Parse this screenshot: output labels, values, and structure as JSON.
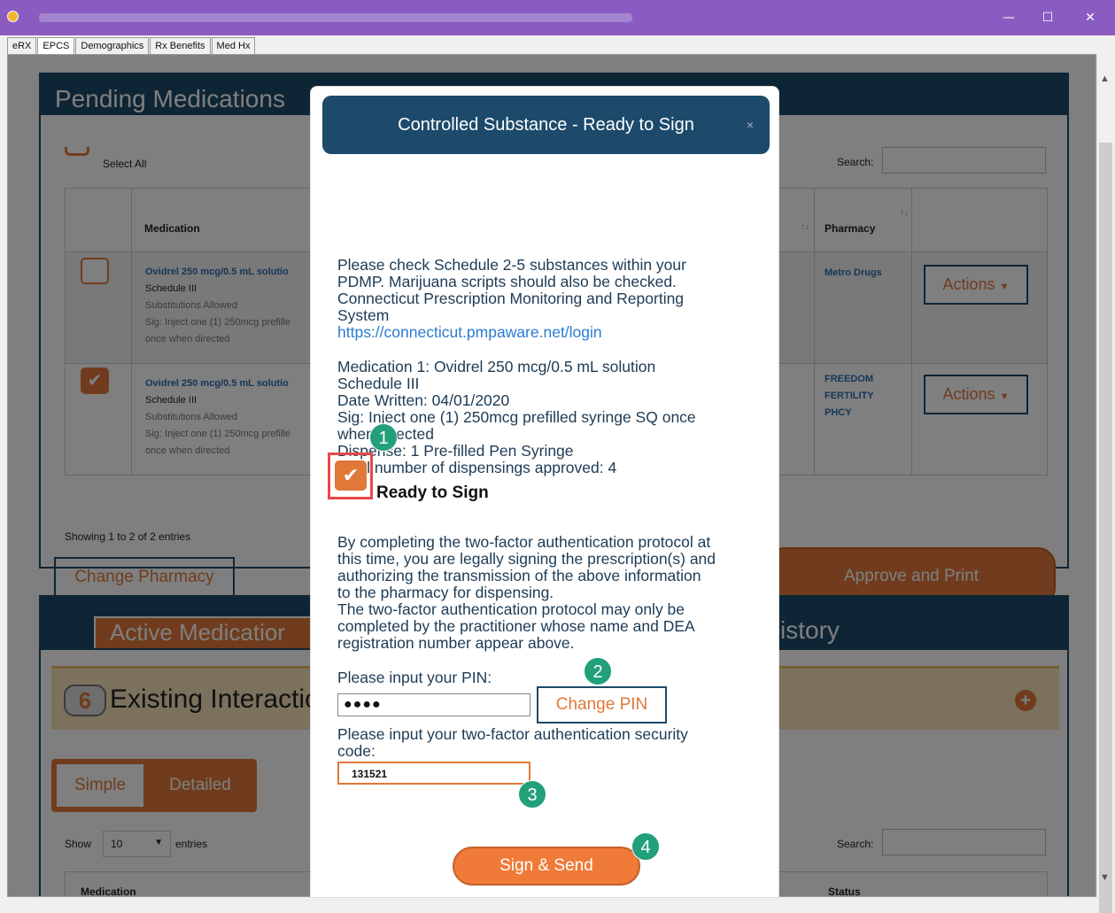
{
  "window": {
    "min": "—",
    "max": "☐",
    "close": "✕"
  },
  "tabs": [
    "eRX",
    "EPCS",
    "Demographics",
    "Rx Benefits",
    "Med Hx"
  ],
  "pending": {
    "title": "Pending Medications",
    "select_all": "Select All",
    "search_label": "Search:",
    "col_medication": "Medication",
    "col_pharmacy": "Pharmacy",
    "sort_icon": "↑↓",
    "rows": [
      {
        "checked": false,
        "med": "Ovidrel 250 mcg/0.5 mL solutio",
        "schedule": "Schedule III",
        "subs": "Substitutions Allowed",
        "sig": "Sig: Inject one (1) 250mcg prefille",
        "sig2": "once when directed",
        "pharmacy": "Metro Drugs",
        "actions": "Actions"
      },
      {
        "checked": true,
        "med": "Ovidrel 250 mcg/0.5 mL solutio",
        "schedule": "Schedule III",
        "subs": "Substitutions Allowed",
        "sig": "Sig: Inject one (1) 250mcg prefille",
        "sig2": "once when directed",
        "pharmacy1": "FREEDOM",
        "pharmacy2": "FERTILITY",
        "pharmacy3": "PHCY",
        "actions": "Actions"
      }
    ],
    "showing": "Showing 1 to 2 of 2 entries",
    "change_pharmacy": "Change Pharmacy",
    "approve_print": "Approve and Print"
  },
  "active": {
    "tab": "Active Medicatior",
    "history": "istory",
    "interactions_count": "6",
    "interactions_label": "Existing Interactio",
    "simple": "Simple",
    "detailed": "Detailed",
    "show": "Show",
    "page_size": "10",
    "entries": "entries",
    "search_label": "Search:",
    "col_medication": "Medication",
    "col_status": "Status"
  },
  "modal": {
    "title": "Controlled Substance - Ready to Sign",
    "close": "×",
    "p1": "Please check Schedule 2-5 substances within your",
    "p2": "PDMP. Marijuana scripts should also be checked.",
    "p3": "Connecticut Prescription Monitoring and Reporting",
    "p4": "System",
    "link": "https://connecticut.pmpaware.net/login",
    "m1": "Medication 1: Ovidrel 250 mcg/0.5 mL solution",
    "m2": "Schedule III",
    "m3": "Date Written: 04/01/2020",
    "m4": "Sig: Inject one (1) 250mcg prefilled syringe SQ once",
    "m5": "when directed",
    "m6": "Dispense: 1 Pre-filled Pen Syringe",
    "m7": "Total number of dispensings approved: 4",
    "ready": "Ready to Sign",
    "a1": "By completing the two-factor authentication protocol at",
    "a2": "this time, you are legally signing the prescription(s) and",
    "a3": "authorizing the transmission of the above information",
    "a4": "to the pharmacy for dispensing.",
    "a5": "The two-factor authentication protocol may only be",
    "a6": "completed by the practitioner whose name and DEA",
    "a7": "registration number appear above.",
    "pin_label": "Please input your PIN:",
    "pin_value": "●●●●",
    "change_pin": "Change PIN",
    "code_label1": "Please input your two-factor authentication security",
    "code_label2": "code:",
    "code_value": "131521",
    "sign_send": "Sign & Send"
  },
  "steps": [
    "1",
    "2",
    "3",
    "4"
  ]
}
